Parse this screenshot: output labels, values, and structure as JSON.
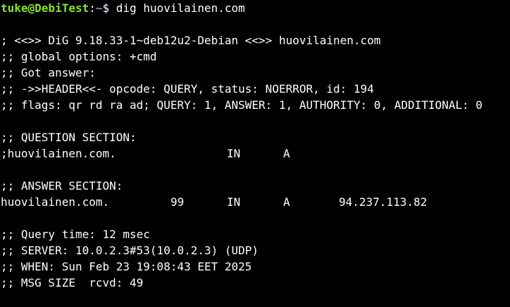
{
  "theme": {
    "background": "#000000",
    "foreground": "#ffffff",
    "prompt_user_color": "#8ae234",
    "prompt_path_color": "#729fcf"
  },
  "prompt": {
    "user_host": "tuke@DebiTest",
    "separator": ":",
    "path": "~",
    "symbol": "$ ",
    "command": "dig huovilainen.com"
  },
  "output": {
    "banner": "; <<>> DiG 9.18.33-1~deb12u2-Debian <<>> huovilainen.com",
    "global_options": ";; global options: +cmd",
    "got_answer": ";; Got answer:",
    "header": ";; ->>HEADER<<- opcode: QUERY, status: NOERROR, id: 194",
    "flags": ";; flags: qr rd ra ad; QUERY: 1, ANSWER: 1, AUTHORITY: 0, ADDITIONAL: 0",
    "question_section_title": ";; QUESTION SECTION:",
    "question": {
      "name": ";huovilainen.com.",
      "class": "IN",
      "type": "A"
    },
    "answer_section_title": ";; ANSWER SECTION:",
    "answer": {
      "name": "huovilainen.com.",
      "ttl": "99",
      "class": "IN",
      "type": "A",
      "address": "94.237.113.82"
    },
    "query_time": ";; Query time: 12 msec",
    "server": ";; SERVER: 10.0.2.3#53(10.0.2.3) (UDP)",
    "when": ";; WHEN: Sun Feb 23 19:08:43 EET 2025",
    "msg_size": ";; MSG SIZE  rcvd: 49"
  }
}
